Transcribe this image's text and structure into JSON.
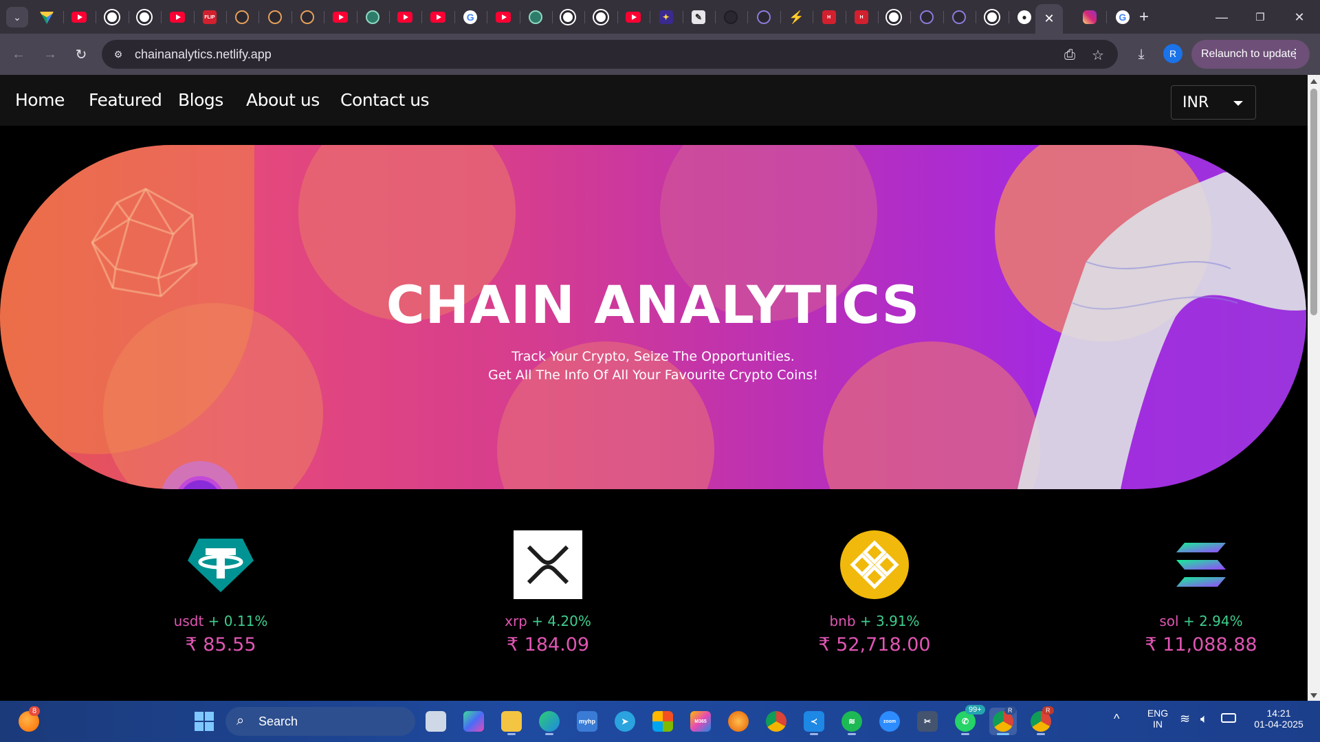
{
  "browser": {
    "tabs": [
      {
        "icon": "google-drive-icon"
      },
      {
        "icon": "youtube-icon"
      },
      {
        "icon": "chatgpt-icon"
      },
      {
        "icon": "chatgpt-icon"
      },
      {
        "icon": "youtube-icon"
      },
      {
        "icon": "red-circle-app-icon",
        "badge_text": "FLIP"
      },
      {
        "icon": "orange-circle-icon"
      },
      {
        "icon": "orange-circle-icon"
      },
      {
        "icon": "orange-circle-icon"
      },
      {
        "icon": "youtube-icon"
      },
      {
        "icon": "green-app-icon"
      },
      {
        "icon": "youtube-icon"
      },
      {
        "icon": "youtube-icon"
      },
      {
        "icon": "google-icon"
      },
      {
        "icon": "youtube-icon"
      },
      {
        "icon": "green-app-icon"
      },
      {
        "icon": "chatgpt-icon"
      },
      {
        "icon": "chatgpt-icon"
      },
      {
        "icon": "youtube-icon"
      },
      {
        "icon": "sparkle-app-icon"
      },
      {
        "icon": "pen-app-icon"
      },
      {
        "icon": "dark-circle-icon"
      },
      {
        "icon": "purple-circle-icon"
      },
      {
        "icon": "bolt-icon"
      },
      {
        "icon": "red-h-icon",
        "badge_text": "H"
      },
      {
        "icon": "red-h-icon",
        "badge_text": "H"
      },
      {
        "icon": "chatgpt-icon"
      },
      {
        "icon": "purple-circle-icon"
      },
      {
        "icon": "purple-circle-icon"
      },
      {
        "icon": "chatgpt-icon"
      },
      {
        "icon": "github-icon"
      },
      {
        "icon": "instagram-icon"
      },
      {
        "icon": "google-icon"
      }
    ],
    "url": "chainanalytics.netlify.app",
    "profile_initial": "R",
    "relaunch_label": "Relaunch to update"
  },
  "site": {
    "nav": [
      "Home",
      "Featured",
      "Blogs",
      "About us",
      "Contact us"
    ],
    "currency": "INR",
    "hero_title": "CHAIN ANALYTICS",
    "hero_line1": "Track Your Crypto, Seize The Opportunities.",
    "hero_line2": "Get All The Info Of All Your Favourite Crypto Coins!",
    "coins": [
      {
        "symbol": "usdt",
        "change": "+ 0.11%",
        "price": "₹ 85.55",
        "icon": "tether-icon",
        "color": "#009393"
      },
      {
        "symbol": "xrp",
        "change": "+ 4.20%",
        "price": "₹ 184.09",
        "icon": "xrp-icon",
        "color": "#ffffff"
      },
      {
        "symbol": "bnb",
        "change": "+ 3.91%",
        "price": "₹ 52,718.00",
        "icon": "bnb-icon",
        "color": "#f0b90b"
      },
      {
        "symbol": "sol",
        "change": "+ 2.94%",
        "price": "₹ 11,088.88",
        "icon": "solana-icon",
        "color": "#9945ff"
      }
    ]
  },
  "taskbar": {
    "notification_count": "8",
    "search_label": "Search",
    "whatsapp_badge": "99+",
    "chrome_profile_badge": "R",
    "lang_top": "ENG",
    "lang_bottom": "IN",
    "time": "14:21",
    "date": "01-04-2025"
  }
}
